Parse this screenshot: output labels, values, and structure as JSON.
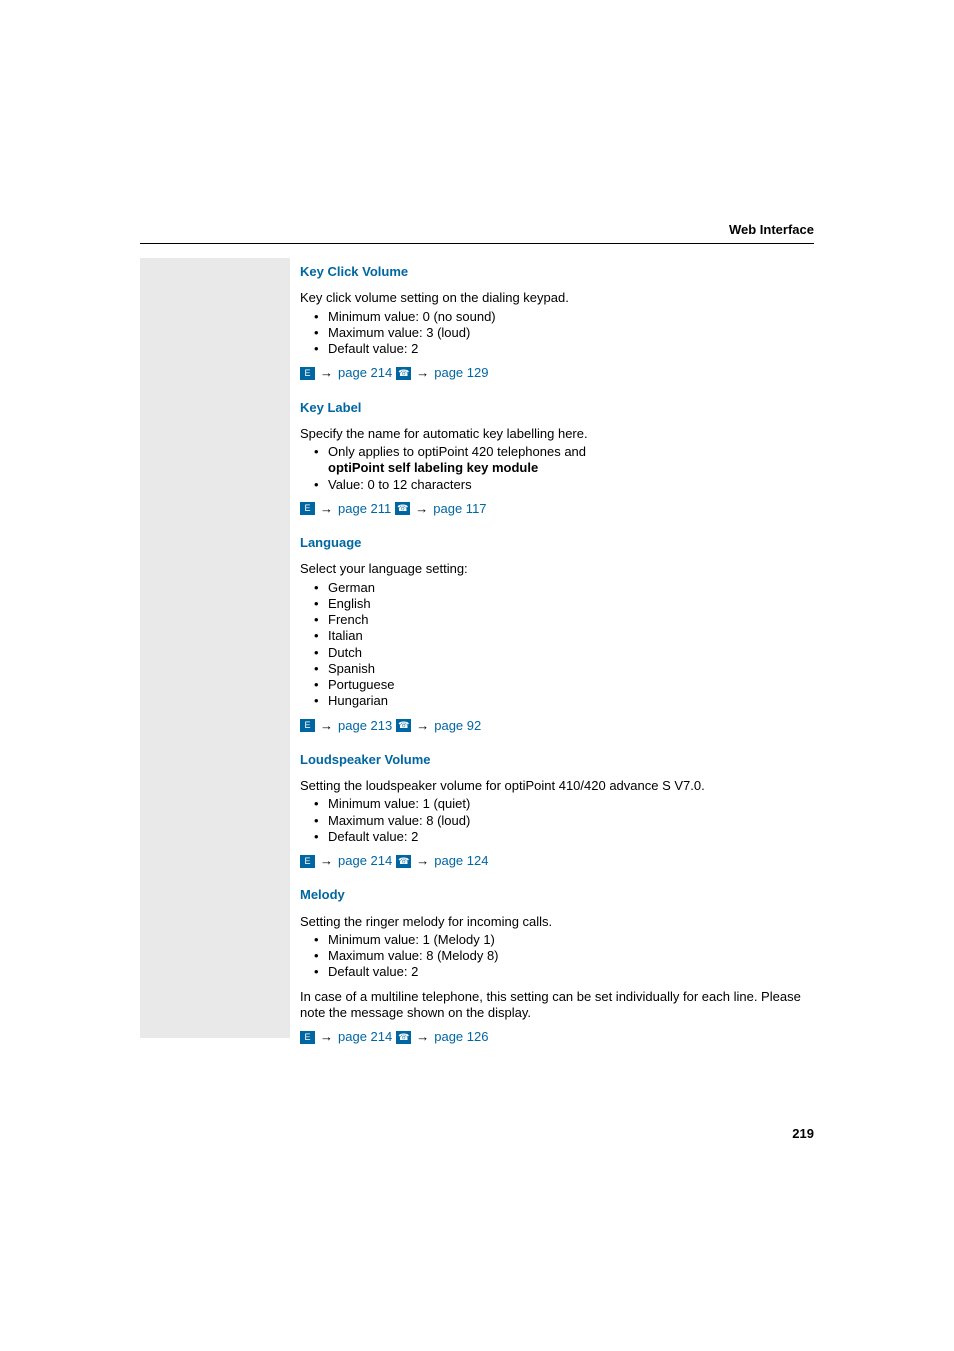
{
  "header": {
    "title": "Web Interface"
  },
  "page_number": "219",
  "sections": [
    {
      "id": "key-click-volume",
      "title": "Key Click Volume",
      "intro": "Key click volume setting on the dialing keypad.",
      "bullets": [
        {
          "text": "Minimum value: 0 (no sound)"
        },
        {
          "text": "Maximum value: 3 (loud)"
        },
        {
          "text": "Default value: 2"
        }
      ],
      "xrefs": [
        {
          "label": "page 214"
        },
        {
          "label": "page 129"
        }
      ]
    },
    {
      "id": "key-label",
      "title": "Key Label",
      "intro": "Specify the name for automatic key labelling here.",
      "bullets": [
        {
          "text": "Only applies to optiPoint 420 telephones and ",
          "bold_cont": "optiPoint self labeling key module"
        },
        {
          "text": "Value: 0 to 12 characters"
        }
      ],
      "xrefs": [
        {
          "label": "page 211"
        },
        {
          "label": "page 117"
        }
      ]
    },
    {
      "id": "language",
      "title": "Language",
      "intro": "Select your language setting:",
      "bullets": [
        {
          "text": "German"
        },
        {
          "text": "English"
        },
        {
          "text": "French"
        },
        {
          "text": "Italian"
        },
        {
          "text": "Dutch"
        },
        {
          "text": "Spanish"
        },
        {
          "text": "Portuguese"
        },
        {
          "text": "Hungarian"
        }
      ],
      "xrefs": [
        {
          "label": "page 213"
        },
        {
          "label": "page 92"
        }
      ]
    },
    {
      "id": "loudspeaker-volume",
      "title": "Loudspeaker Volume",
      "intro": "Setting the loudspeaker volume for optiPoint 410/420 advance S V7.0.",
      "bullets": [
        {
          "text": "Minimum value: 1 (quiet)"
        },
        {
          "text": "Maximum value: 8 (loud)"
        },
        {
          "text": "Default value: 2"
        }
      ],
      "xrefs": [
        {
          "label": "page 214"
        },
        {
          "label": "page 124"
        }
      ]
    },
    {
      "id": "melody",
      "title": "Melody",
      "intro": "Setting the ringer melody for incoming calls.",
      "bullets": [
        {
          "text": "Minimum value: 1 (Melody 1)"
        },
        {
          "text": "Maximum value: 8 (Melody 8)"
        },
        {
          "text": "Default value: 2"
        }
      ],
      "extra_para": "In case of a multiline telephone, this setting can be set individually for each line. Please note the message shown on the display.",
      "xrefs": [
        {
          "label": "page 214"
        },
        {
          "label": "page 126"
        }
      ]
    }
  ]
}
